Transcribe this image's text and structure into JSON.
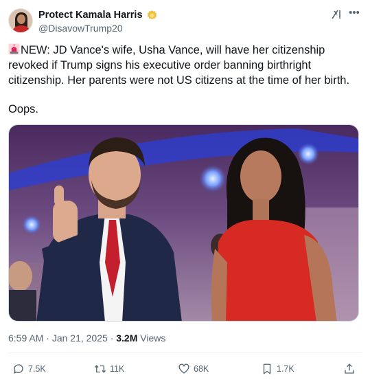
{
  "author": {
    "display_name": "Protect Kamala Harris",
    "handle": "@DisavowTrump20"
  },
  "post": {
    "text": "NEW: JD Vance's wife, Usha Vance, will have her citizenship revoked if Trump signs his executive order banning birthright citizenship. Her parents were not US citizens at the time of her birth.",
    "text_2": "Oops."
  },
  "meta": {
    "time": "6:59 AM",
    "sep1": "·",
    "date": "Jan 21, 2025",
    "sep2": "·",
    "views": "3.2M",
    "views_label": "Views"
  },
  "actions": {
    "replies": "7.5K",
    "reposts": "11K",
    "likes": "68K",
    "bookmarks": "1.7K"
  },
  "icons": {
    "leading_emoji": "rotating-light-icon",
    "badge": "gold-badge-icon",
    "grok": "grok-icon",
    "more": "more-icon",
    "reply": "reply-icon",
    "repost": "repost-icon",
    "like": "heart-icon",
    "bookmark": "bookmark-icon",
    "share": "share-icon"
  },
  "colors": {
    "text": "#0f1419",
    "secondary": "#536471",
    "badge": "#f0c040",
    "siren": "#e0245e"
  }
}
